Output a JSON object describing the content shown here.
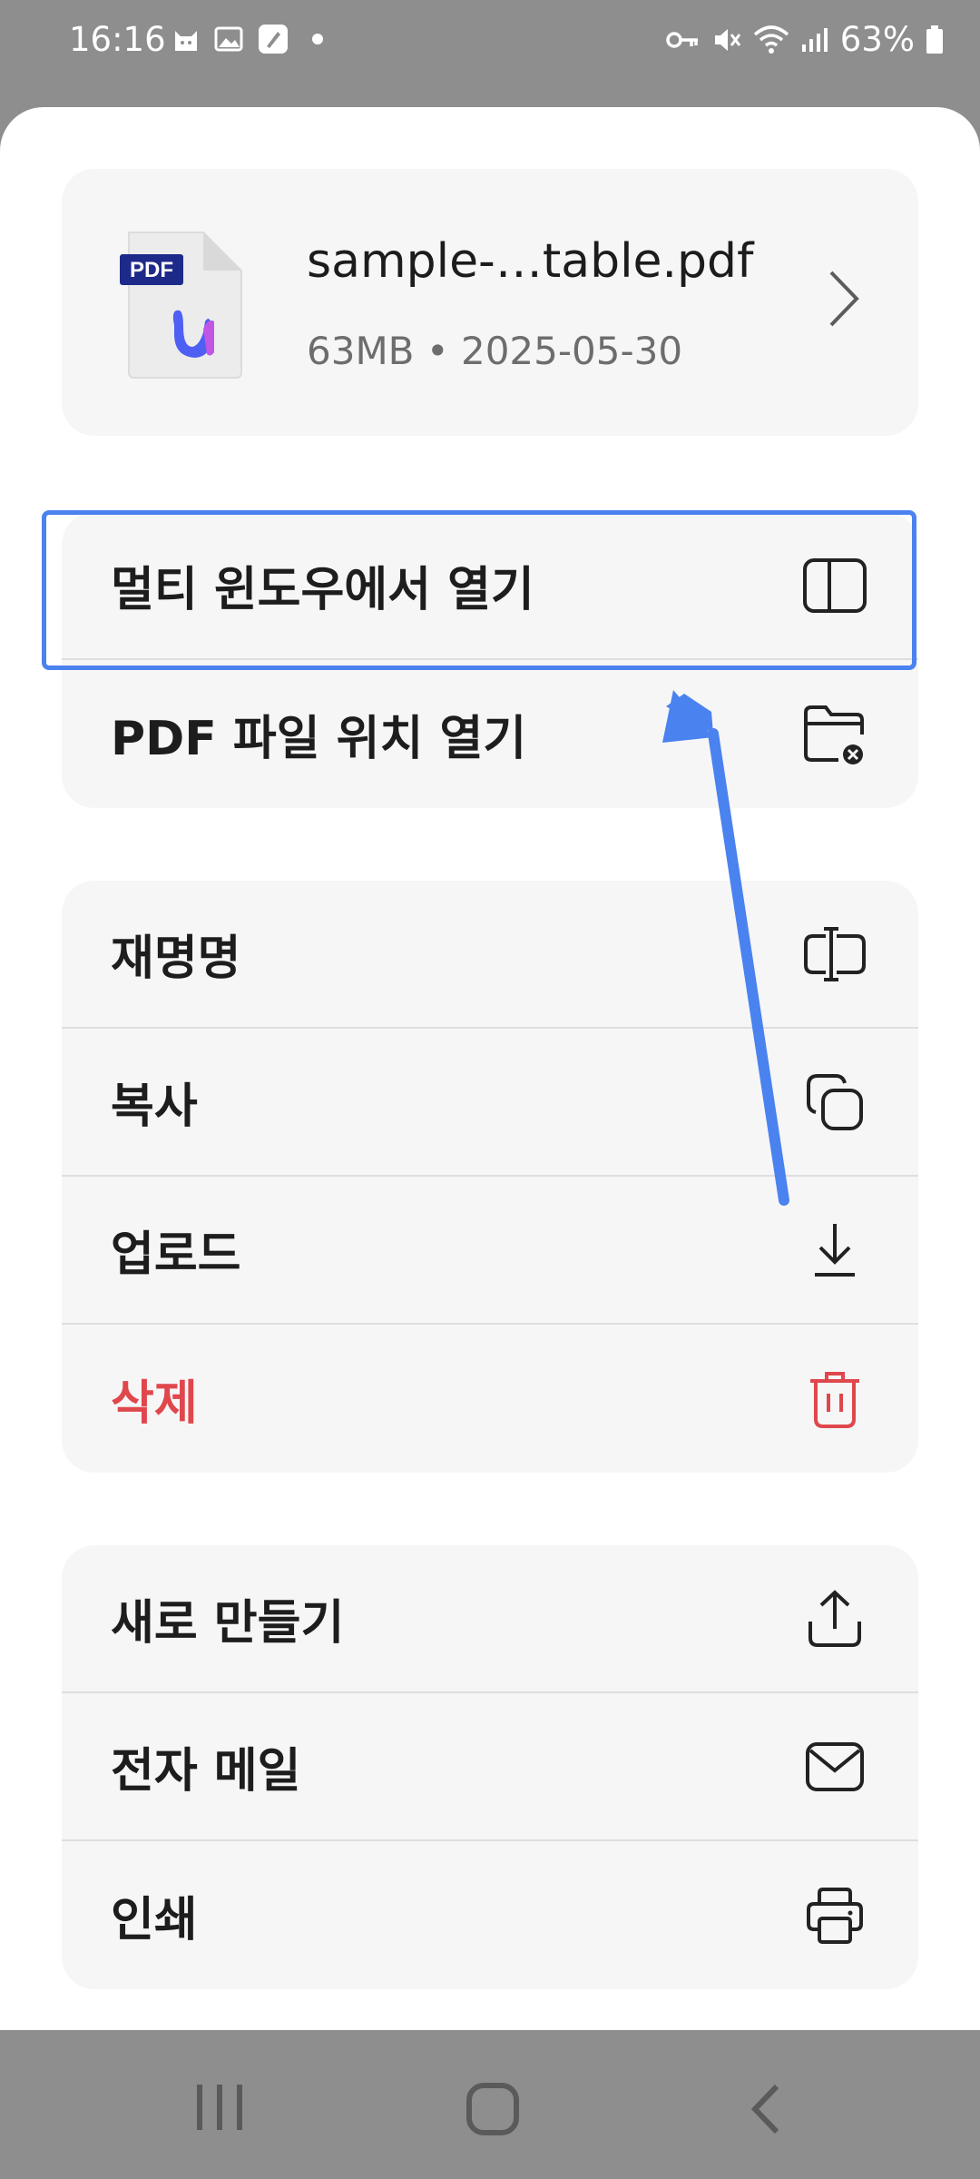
{
  "status_bar": {
    "time": "16:16",
    "battery": "63%",
    "left_icons": [
      "cat-icon",
      "image-icon",
      "pen-icon",
      "dot-icon"
    ],
    "right_icons": [
      "key-icon",
      "mute-icon",
      "wifi-icon",
      "signal-icon",
      "battery-icon"
    ]
  },
  "file": {
    "thumb_badge": "PDF",
    "name": "sample-…table.pdf",
    "meta": "63MB • 2025-05-30"
  },
  "menu_group_1": [
    {
      "label": "멀티 윈도우에서 열기",
      "icon": "split-window-icon"
    },
    {
      "label": "PDF 파일 위치 열기",
      "icon": "folder-icon"
    }
  ],
  "menu_group_2": [
    {
      "label": "재명명",
      "icon": "rename-icon"
    },
    {
      "label": "복사",
      "icon": "copy-icon"
    },
    {
      "label": "업로드",
      "icon": "download-icon"
    },
    {
      "label": "삭제",
      "icon": "trash-icon"
    }
  ],
  "menu_group_3": [
    {
      "label": "새로 만들기",
      "icon": "share-icon"
    },
    {
      "label": "전자 메일",
      "icon": "mail-icon"
    },
    {
      "label": "인쇄",
      "icon": "printer-icon"
    }
  ],
  "colors": {
    "highlight": "#4a82ef",
    "danger": "#e0474c",
    "card_bg": "#f6f6f7",
    "pdf_badge": "#1e2a8a"
  },
  "nav_bar": [
    "recent-apps-icon",
    "home-icon",
    "back-icon"
  ]
}
